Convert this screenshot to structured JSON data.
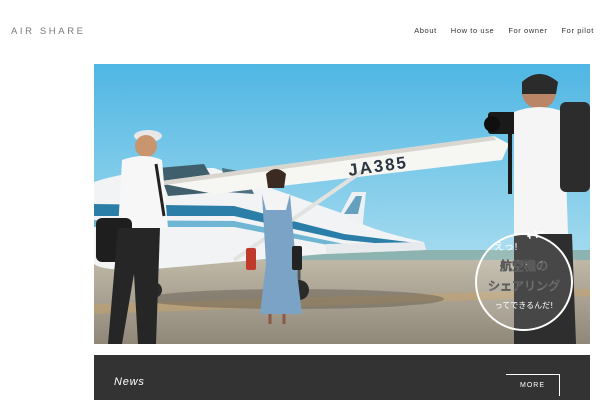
{
  "header": {
    "logo": "AIR SHARE",
    "nav": [
      {
        "label": "About"
      },
      {
        "label": "How to use"
      },
      {
        "label": "For owner"
      },
      {
        "label": "For pilot"
      }
    ]
  },
  "hero": {
    "aircraft_registration": "JA385",
    "badge": {
      "line1": "えっ!",
      "line2": "航空機の",
      "line3": "シェアリング",
      "line4": "ってできるんだ!"
    }
  },
  "news": {
    "title": "News",
    "more_label": "MORE"
  },
  "colors": {
    "news_bar": "#333333",
    "sky": "#6fc4e6",
    "stripe": "#2b7ea8"
  },
  "icons": {
    "badge_plane": "airplane-icon"
  }
}
